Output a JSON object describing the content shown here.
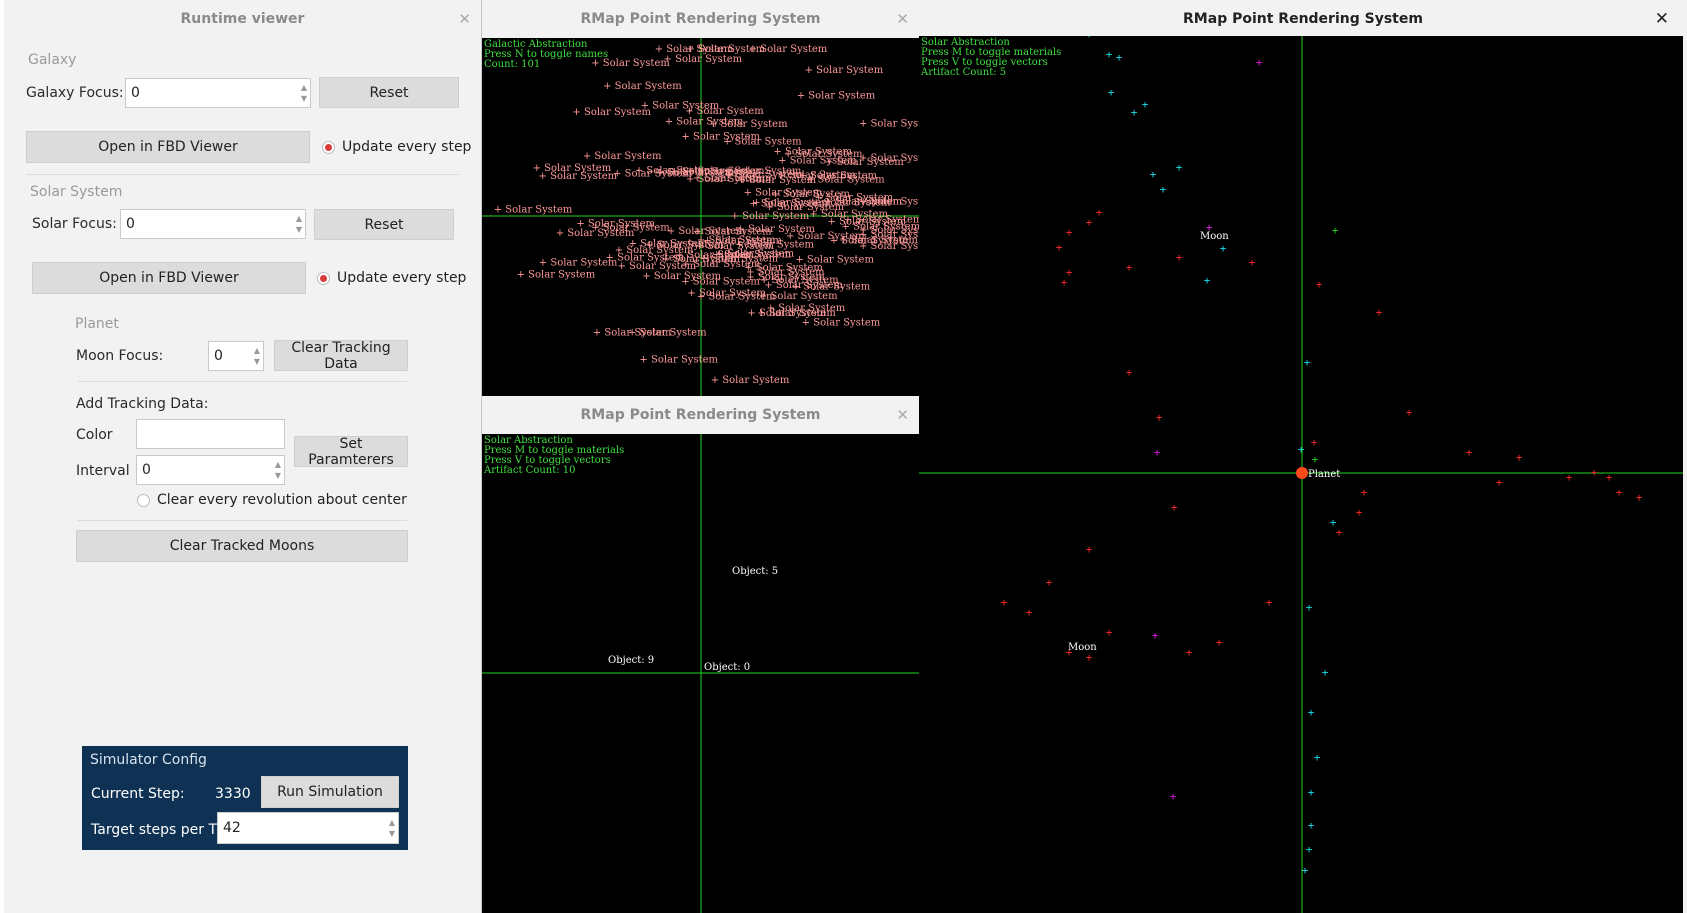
{
  "runtime": {
    "title": "Runtime viewer",
    "galaxy": {
      "section": "Galaxy",
      "focus_label": "Galaxy Focus:",
      "focus_value": "0",
      "reset": "Reset",
      "open_fbd": "Open in FBD Viewer",
      "update_every_step": "Update every step"
    },
    "solar": {
      "section": "Solar System",
      "focus_label": "Solar Focus:",
      "focus_value": "0",
      "reset": "Reset",
      "open_fbd": "Open in FBD Viewer",
      "update_every_step": "Update every step"
    },
    "planet": {
      "section": "Planet",
      "moon_focus_label": "Moon Focus:",
      "moon_focus_value": "0",
      "clear_tracking": "Clear Tracking Data",
      "add_tracking": "Add Tracking Data:",
      "color_label": "Color",
      "color_value": "",
      "interval_label": "Interval",
      "interval_value": "0",
      "set_params": "Set Paramterers",
      "clear_every_rev": "Clear every revolution about center",
      "clear_tracked": "Clear Tracked Moons"
    },
    "sim": {
      "section": "Simulator Config",
      "current_step_label": "Current Step:",
      "current_step_value": "3330",
      "run": "Run Simulation",
      "target_label": "Target steps per T",
      "target_value": "42"
    }
  },
  "galactic_window": {
    "title": "RMap Point Rendering System",
    "hud": [
      "Galactic Abstraction",
      "Press N to toggle names",
      "Count: 101"
    ],
    "point_label": "Solar System"
  },
  "solar_window": {
    "title": "RMap Point Rendering System",
    "hud": [
      "Solar Abstraction",
      "Press M to toggle materials",
      "Press V to toggle vectors",
      "Artifact Count: 10"
    ],
    "labels": [
      "Object: 5",
      "Object: 9",
      "Object: 0"
    ]
  },
  "planet_window": {
    "title": "RMap Point Rendering System",
    "hud": [
      "Solar Abstraction",
      "Press M to toggle materials",
      "Press V to toggle vectors",
      "Artifact Count: 5"
    ],
    "labels": [
      "Moon",
      "Planet",
      "Moon"
    ]
  },
  "colors": {
    "panel_bg": "#f2f2f2",
    "sim_panel_bg": "#0e3154",
    "radio_selected": "#d93a3a",
    "axis_green": "#22d422",
    "hud_green": "#3fe03f",
    "galaxy_marker": "#ff9a9a",
    "planet_red": "#ff2a2a",
    "planet_cyan": "#18e0e8",
    "planet_magenta": "#e020e0",
    "planet_center": "#ff4a1a"
  }
}
